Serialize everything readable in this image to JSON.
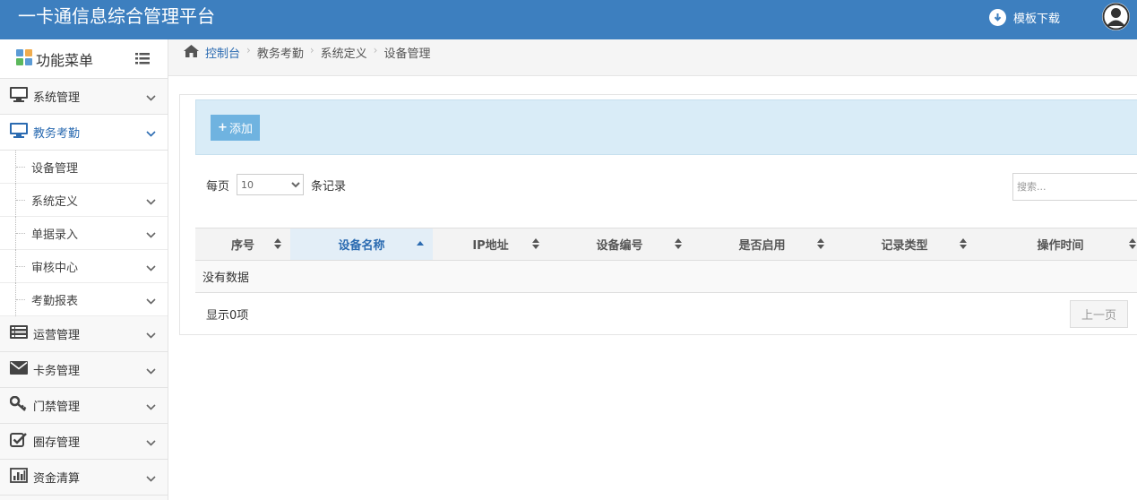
{
  "header": {
    "app_title": "一卡通信息综合管理平台",
    "template_download_label": "模板下载"
  },
  "sidebar": {
    "title": "功能菜单",
    "items": [
      {
        "label": "系统管理",
        "icon": "monitor-icon"
      },
      {
        "label": "教务考勤",
        "icon": "monitor-icon",
        "active": true
      },
      {
        "label": "运营管理",
        "icon": "list-icon"
      },
      {
        "label": "卡务管理",
        "icon": "envelope-icon"
      },
      {
        "label": "门禁管理",
        "icon": "key-icon"
      },
      {
        "label": "圈存管理",
        "icon": "check-square-icon"
      },
      {
        "label": "资金清算",
        "icon": "bar-chart-icon"
      }
    ],
    "sub_items": [
      {
        "label": "设备管理"
      },
      {
        "label": "系统定义"
      },
      {
        "label": "单据录入"
      },
      {
        "label": "审核中心"
      },
      {
        "label": "考勤报表"
      }
    ]
  },
  "breadcrumb": {
    "home": "控制台",
    "level1": "教务考勤",
    "level2": "系统定义",
    "level3": "设备管理"
  },
  "toolbar": {
    "add_label": "添加"
  },
  "list": {
    "per_page_label": "每页",
    "per_page_value": "10",
    "records_label": "条记录",
    "search_placeholder": "搜索...",
    "columns": [
      "序号",
      "设备名称",
      "IP地址",
      "设备编号",
      "是否启用",
      "记录类型",
      "操作时间"
    ],
    "sorted_column": "设备名称",
    "empty_text": "没有数据",
    "info_text": "显示0项",
    "prev_label": "上一页"
  },
  "colors": {
    "header_bg": "#3d7fbf",
    "accent": "#2b6bb1",
    "toolbar_bg": "#d9ecf7",
    "add_button": "#6fb3e0"
  }
}
